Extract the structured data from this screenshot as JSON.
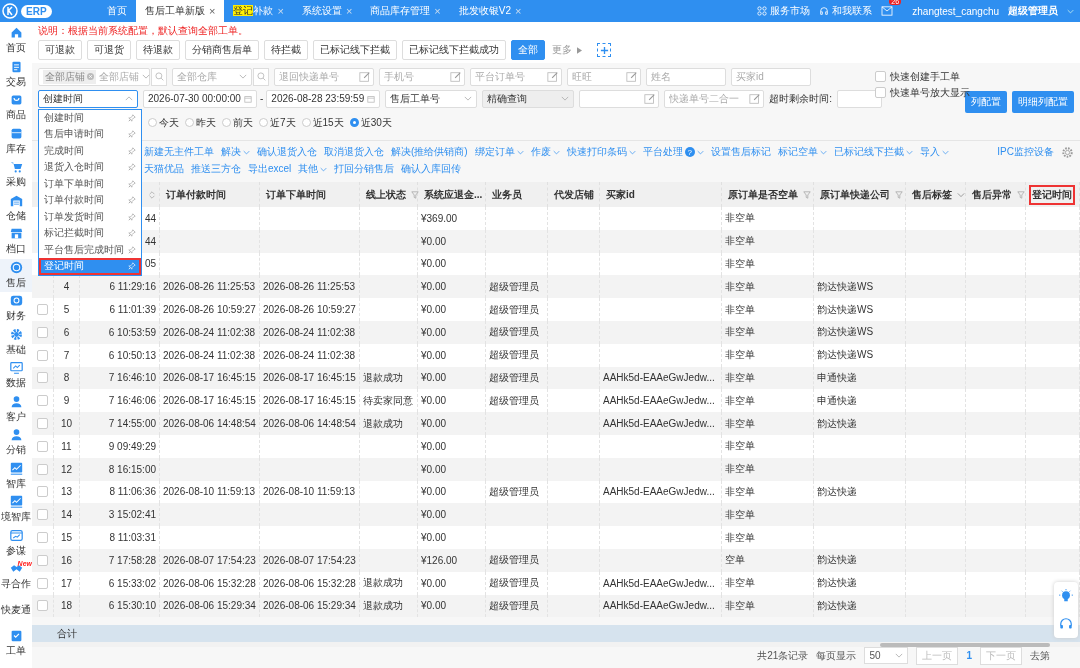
{
  "top_bar": {
    "logo_text": "ERP",
    "tabs": [
      {
        "label": "首页",
        "selected": false
      },
      {
        "label": "售后工单新版",
        "selected": true,
        "close": "×"
      },
      {
        "highlight": "登记",
        "label": "补款",
        "selected": false,
        "close": "×"
      },
      {
        "label": "系统设置",
        "selected": false,
        "close": "×"
      },
      {
        "label": "商品库存管理",
        "selected": false,
        "close": "×"
      },
      {
        "label": "批发收银V2",
        "selected": false,
        "close": "×"
      }
    ],
    "links": [
      "服务市场",
      "和我联系"
    ],
    "mail_badge": "26",
    "user": "zhangtest_cangchu",
    "role": "超级管理员"
  },
  "sidebar": {
    "items": [
      {
        "label": "首页",
        "selected": false
      },
      {
        "label": "交易",
        "selected": false
      },
      {
        "label": "商品",
        "selected": false
      },
      {
        "label": "库存",
        "selected": false
      },
      {
        "label": "采购",
        "selected": false
      },
      {
        "label": "仓储",
        "selected": false
      },
      {
        "label": "档口",
        "selected": false
      },
      {
        "label": "售后",
        "selected": true
      },
      {
        "label": "财务",
        "selected": false
      },
      {
        "label": "基础",
        "selected": false
      },
      {
        "label": "数据",
        "selected": false
      },
      {
        "label": "客户",
        "selected": false
      },
      {
        "label": "分销",
        "selected": false
      },
      {
        "label": "智库",
        "selected": false
      },
      {
        "label": "境智库",
        "selected": false
      },
      {
        "label": "参谋",
        "selected": false
      },
      {
        "label": "寻合作",
        "selected": false,
        "badge": "New"
      },
      {
        "label": "快麦通",
        "selected": false
      },
      {
        "label": "工单",
        "selected": false
      }
    ]
  },
  "notice": "说明：根据当前系统配置，默认查询全部工单。",
  "quick_filters": [
    {
      "label": "可退款",
      "selected": false
    },
    {
      "label": "可退货",
      "selected": false
    },
    {
      "label": "待退款",
      "selected": false
    },
    {
      "label": "分销商售后单",
      "selected": false
    },
    {
      "label": "待拦截",
      "selected": false
    },
    {
      "label": "已标记线下拦截",
      "selected": false
    },
    {
      "label": "已标记线下拦截成功",
      "selected": false
    },
    {
      "label": "全部",
      "selected": true
    }
  ],
  "more_link": "更多",
  "filters_row_1": [
    {
      "kind": "tag-select",
      "tag": "全部店铺",
      "placeholder": "全部店铺"
    },
    {
      "kind": "select",
      "placeholder": "全部仓库",
      "search": true
    },
    {
      "kind": "input",
      "placeholder": "退回快递单号",
      "edit": true
    },
    {
      "kind": "input",
      "placeholder": "手机号",
      "edit": true
    },
    {
      "kind": "input",
      "placeholder": "平台订单号",
      "edit": true
    },
    {
      "kind": "input",
      "placeholder": "旺旺",
      "edit": true
    },
    {
      "kind": "input",
      "placeholder": "姓名",
      "edit": false
    },
    {
      "kind": "input",
      "placeholder": "买家id",
      "edit": false
    }
  ],
  "options": [
    {
      "label": "快速创建手工单",
      "checked": false
    },
    {
      "label": "快速单号放大显示",
      "checked": false
    }
  ],
  "filters_row_2": [
    {
      "kind": "time-select",
      "value": "创建时间",
      "expanded": true
    },
    {
      "kind": "date-range",
      "from": "2026-07-30 00:00:00",
      "separator": "-",
      "to": "2026-08-28 23:59:59"
    },
    {
      "kind": "select",
      "value": "售后工单号",
      "disabled": false
    },
    {
      "kind": "select",
      "value": "精确查询",
      "disabled": true
    },
    {
      "kind": "input",
      "edit": true
    },
    {
      "kind": "input",
      "placeholder": "快递单号二合一",
      "edit": true
    },
    {
      "kind": "label",
      "text": "超时剩余时间:"
    },
    {
      "kind": "input",
      "edit": false
    }
  ],
  "config_buttons": [
    "列配置",
    "明细列配置"
  ],
  "time_menu": {
    "items": [
      {
        "label": "创建时间",
        "selected": false,
        "annotated": false
      },
      {
        "label": "售后申请时间",
        "selected": false,
        "annotated": false
      },
      {
        "label": "完成时间",
        "selected": false,
        "annotated": false
      },
      {
        "label": "退货入仓时间",
        "selected": false,
        "annotated": false
      },
      {
        "label": "订单下单时间",
        "selected": false,
        "annotated": false
      },
      {
        "label": "订单付款时间",
        "selected": false,
        "annotated": false
      },
      {
        "label": "订单发货时间",
        "selected": false,
        "annotated": false
      },
      {
        "label": "标记拦截时间",
        "selected": false,
        "annotated": false
      },
      {
        "label": "平台售后完成时间",
        "selected": false,
        "annotated": false
      },
      {
        "label": "登记时间",
        "selected": true,
        "annotated": true
      }
    ]
  },
  "date_shortcuts": [
    {
      "label": "今天",
      "selected": false
    },
    {
      "label": "昨天",
      "selected": false
    },
    {
      "label": "前天",
      "selected": false
    },
    {
      "label": "近7天",
      "selected": false
    },
    {
      "label": "近15天",
      "selected": false
    },
    {
      "label": "近30天",
      "selected": true
    }
  ],
  "actions_row_1": [
    {
      "label": "新建无主件工单",
      "caret": false
    },
    {
      "label": "解决",
      "caret": true
    },
    {
      "label": "确认退货入仓",
      "caret": false
    },
    {
      "label": "取消退货入仓",
      "caret": false
    },
    {
      "label": "解决(推给供销商)",
      "caret": false
    },
    {
      "label": "绑定订单",
      "caret": true
    },
    {
      "label": "作废",
      "caret": true
    },
    {
      "label": "快速打印条码",
      "caret": true
    },
    {
      "label": "平台处理",
      "caret": true,
      "help": "?"
    },
    {
      "label": "设置售后标记",
      "caret": false
    },
    {
      "label": "标记空单",
      "caret": true
    },
    {
      "label": "已标记线下拦截",
      "caret": true
    },
    {
      "label": "导入",
      "caret": true
    }
  ],
  "actions_row_2": [
    {
      "label": "天猫优品",
      "caret": false
    },
    {
      "label": "推送三方仓",
      "caret": false
    },
    {
      "label": "导出excel",
      "caret": false
    },
    {
      "label": "其他",
      "caret": true
    },
    {
      "label": "打回分销售后",
      "caret": false
    },
    {
      "label": "确认入库回传",
      "caret": false
    }
  ],
  "ipc_link": "IPC监控设备",
  "table": {
    "columns": [
      {
        "kind": "sort"
      },
      {
        "label": "订单付款时间",
        "kind": "plain",
        "annotated": false
      },
      {
        "label": "订单下单时间",
        "kind": "plain",
        "annotated": false
      },
      {
        "label": "线上状态",
        "kind": "filter",
        "annotated": false
      },
      {
        "label": "系统应退金...",
        "kind": "plain",
        "annotated": false
      },
      {
        "label": "业务员",
        "kind": "plain",
        "annotated": false
      },
      {
        "label": "代发店铺",
        "kind": "plain",
        "annotated": false
      },
      {
        "label": "买家id",
        "kind": "plain",
        "annotated": false
      },
      {
        "label": "原订单是否空单",
        "kind": "filter",
        "annotated": false
      },
      {
        "label": "原订单快递公司",
        "kind": "filter",
        "annotated": false
      },
      {
        "label": "售后标签",
        "kind": "caret",
        "annotated": false
      },
      {
        "label": "售后异常",
        "kind": "filter",
        "annotated": false
      },
      {
        "label": "登记时间",
        "kind": "plain",
        "annotated": true
      }
    ],
    "rows": [
      {
        "col_3": "44",
        "refund": "¥369.00",
        "empty_order": "非空单"
      },
      {
        "col_3": "44",
        "refund": "¥0.00",
        "empty_order": "非空单"
      },
      {
        "col_3": "05",
        "refund": "¥0.00",
        "empty_order": "非空单"
      },
      {
        "index": "4",
        "col_3": "6 11:29:16",
        "pay_time": "2026-08-26 11:25:53",
        "order_time": "2026-08-26 11:25:53",
        "refund": "¥0.00",
        "salesman": "超级管理员",
        "empty_order": "非空单",
        "courier": "韵达快递WS"
      },
      {
        "index": "5",
        "checked": false,
        "col_3": "6 11:01:39",
        "pay_time": "2026-08-26 10:59:27",
        "order_time": "2026-08-26 10:59:27",
        "refund": "¥0.00",
        "salesman": "超级管理员",
        "empty_order": "非空单",
        "courier": "韵达快递WS"
      },
      {
        "index": "6",
        "checked": false,
        "col_3": "6 10:53:59",
        "pay_time": "2026-08-24 11:02:38",
        "order_time": "2026-08-24 11:02:38",
        "refund": "¥0.00",
        "salesman": "超级管理员",
        "empty_order": "非空单",
        "courier": "韵达快递WS"
      },
      {
        "index": "7",
        "checked": false,
        "col_3": "6 10:50:13",
        "pay_time": "2026-08-24 11:02:38",
        "order_time": "2026-08-24 11:02:38",
        "refund": "¥0.00",
        "salesman": "超级管理员",
        "empty_order": "非空单",
        "courier": "韵达快递WS"
      },
      {
        "index": "8",
        "checked": false,
        "col_3": "7 16:46:10",
        "pay_time": "2026-08-17 16:45:15",
        "order_time": "2026-08-17 16:45:15",
        "online_status": "退款成功",
        "refund": "¥0.00",
        "salesman": "超级管理员",
        "buyer_id": "AAHk5d-EAAeGwJedw...",
        "empty_order": "非空单",
        "courier": "申通快递"
      },
      {
        "index": "9",
        "checked": false,
        "col_3": "7 16:46:06",
        "pay_time": "2026-08-17 16:45:15",
        "order_time": "2026-08-17 16:45:15",
        "online_status": "待卖家同意",
        "refund": "¥0.00",
        "salesman": "超级管理员",
        "buyer_id": "AAHk5d-EAAeGwJedw...",
        "empty_order": "非空单",
        "courier": "申通快递"
      },
      {
        "index": "10",
        "checked": false,
        "col_3": "7 14:55:00",
        "pay_time": "2026-08-06 14:48:54",
        "order_time": "2026-08-06 14:48:54",
        "online_status": "退款成功",
        "refund": "¥0.00",
        "buyer_id": "AAHk5d-EAAeGwJedw...",
        "empty_order": "非空单",
        "courier": "韵达快递"
      },
      {
        "index": "11",
        "checked": false,
        "col_3": "9 09:49:29",
        "refund": "¥0.00",
        "empty_order": "非空单"
      },
      {
        "index": "12",
        "checked": false,
        "col_3": "8 16:15:00",
        "refund": "¥0.00",
        "empty_order": "非空单"
      },
      {
        "index": "13",
        "checked": false,
        "col_3": "8 11:06:36",
        "pay_time": "2026-08-10 11:59:13",
        "order_time": "2026-08-10 11:59:13",
        "refund": "¥0.00",
        "salesman": "超级管理员",
        "buyer_id": "AAHk5d-EAAeGwJedw...",
        "empty_order": "非空单",
        "courier": "韵达快递"
      },
      {
        "index": "14",
        "checked": false,
        "col_3": "3 15:02:41",
        "refund": "¥0.00",
        "empty_order": "非空单"
      },
      {
        "index": "15",
        "checked": false,
        "col_3": "8 11:03:31",
        "refund": "¥0.00",
        "empty_order": "非空单"
      },
      {
        "index": "16",
        "checked": false,
        "col_3": "7 17:58:28",
        "pay_time": "2026-08-07 17:54:23",
        "order_time": "2026-08-07 17:54:23",
        "refund": "¥126.00",
        "salesman": "超级管理员",
        "empty_order": "空单",
        "courier": "韵达快递"
      },
      {
        "index": "17",
        "checked": false,
        "col_3": "6 15:33:02",
        "pay_time": "2026-08-06 15:32:28",
        "order_time": "2026-08-06 15:32:28",
        "online_status": "退款成功",
        "refund": "¥0.00",
        "salesman": "超级管理员",
        "buyer_id": "AAHk5d-EAAeGwJedw...",
        "empty_order": "非空单",
        "courier": "韵达快递"
      },
      {
        "index": "18",
        "checked": false,
        "col_3": "6 15:30:10",
        "pay_time": "2026-08-06 15:29:34",
        "order_time": "2026-08-06 15:29:34",
        "online_status": "退款成功",
        "refund": "¥0.00",
        "salesman": "超级管理员",
        "buyer_id": "AAHk5d-EAAeGwJedw...",
        "empty_order": "非空单",
        "courier": "韵达快递"
      }
    ],
    "total_label": "合计"
  },
  "pagination": {
    "total": "共21条记录",
    "page_size_label": "每页显示",
    "page_size": "50",
    "prev": "上一页",
    "pages": [
      {
        "label": "1",
        "selected": true
      }
    ],
    "next": "下一页",
    "goto": "去第"
  }
}
